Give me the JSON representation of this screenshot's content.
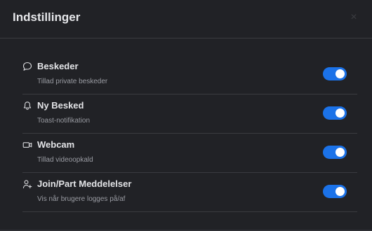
{
  "dialog": {
    "title": "Indstillinger",
    "close_label": "×"
  },
  "settings": [
    {
      "icon": "chat-bubble-icon",
      "label": "Beskeder",
      "description": "Tillad private beskeder",
      "enabled": true
    },
    {
      "icon": "bell-icon",
      "label": "Ny Besked",
      "description": "Toast-notifikation",
      "enabled": true
    },
    {
      "icon": "video-camera-icon",
      "label": "Webcam",
      "description": "Tillad videoopkald",
      "enabled": true
    },
    {
      "icon": "user-plus-icon",
      "label": "Join/Part Meddelelser",
      "description": "Vis når brugere logges på/af",
      "enabled": true
    }
  ],
  "colors": {
    "toggle_on": "#1b72e8",
    "background": "#212226"
  }
}
